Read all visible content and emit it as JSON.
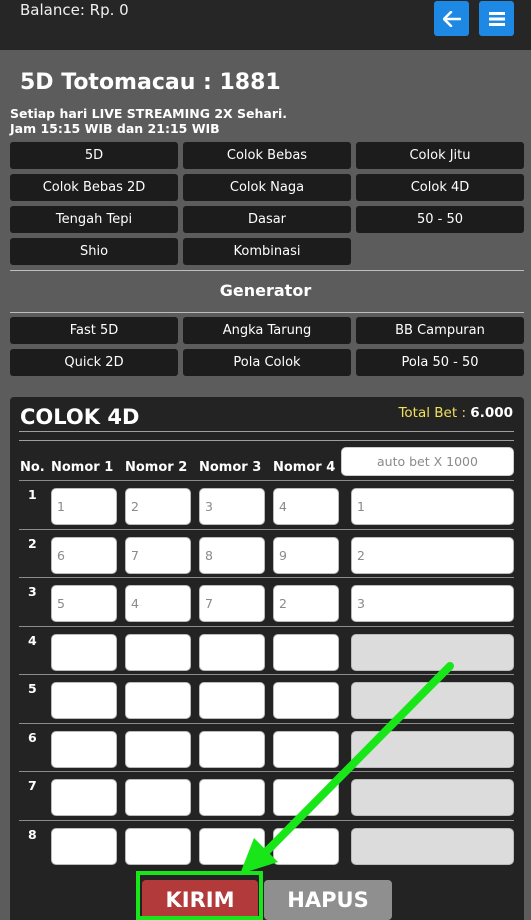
{
  "header": {
    "balance": "Balance: Rp. 0",
    "back_icon": "arrow-left-icon",
    "menu_icon": "hamburger-menu-icon",
    "accent": "#1e88e5"
  },
  "title": "5D Totomacau : 1881",
  "info_line1": "Setiap hari LIVE STREAMING 2X Sehari.",
  "info_line2": "Jam 15:15 WIB dan 21:15 WIB",
  "games": [
    "5D",
    "Colok Bebas",
    "Colok Jitu",
    "Colok Bebas 2D",
    "Colok Naga",
    "Colok 4D",
    "Tengah Tepi",
    "Dasar",
    "50 - 50",
    "Shio",
    "Kombinasi"
  ],
  "generator": {
    "title": "Generator",
    "items": [
      "Fast 5D",
      "Angka Tarung",
      "BB Campuran",
      "Quick 2D",
      "Pola Colok",
      "Pola 50 - 50"
    ]
  },
  "form": {
    "title": "COLOK 4D",
    "total_bet_label": "Total Bet :",
    "total_bet_value": "6.000",
    "headers": [
      "No.",
      "Nomor 1",
      "Nomor 2",
      "Nomor 3",
      "Nomor 4"
    ],
    "autobet_placeholder": "auto bet X 1000",
    "rows": [
      {
        "no": "1",
        "n1": "1",
        "n2": "2",
        "n3": "3",
        "n4": "4",
        "bet": "1"
      },
      {
        "no": "2",
        "n1": "6",
        "n2": "7",
        "n3": "8",
        "n4": "9",
        "bet": "2"
      },
      {
        "no": "3",
        "n1": "5",
        "n2": "4",
        "n3": "7",
        "n4": "2",
        "bet": "3"
      },
      {
        "no": "4",
        "n1": "",
        "n2": "",
        "n3": "",
        "n4": "",
        "bet": ""
      },
      {
        "no": "5",
        "n1": "",
        "n2": "",
        "n3": "",
        "n4": "",
        "bet": ""
      },
      {
        "no": "6",
        "n1": "",
        "n2": "",
        "n3": "",
        "n4": "",
        "bet": ""
      },
      {
        "no": "7",
        "n1": "",
        "n2": "",
        "n3": "",
        "n4": "",
        "bet": ""
      },
      {
        "no": "8",
        "n1": "",
        "n2": "",
        "n3": "",
        "n4": "",
        "bet": ""
      }
    ]
  },
  "actions": {
    "kirim": "KIRIM",
    "hapus": "HAPUS",
    "kirim_color": "#b23a3a",
    "highlight_color": "#19e619"
  }
}
